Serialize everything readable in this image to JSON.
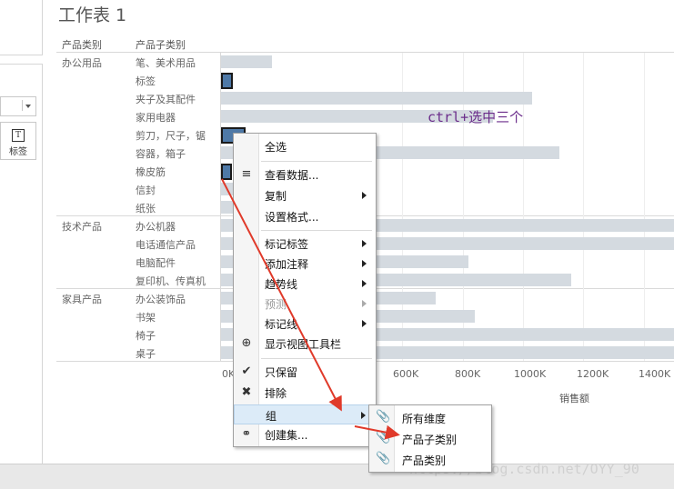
{
  "worksheet": {
    "title": "工作表 1",
    "col_category_header": "产品类别",
    "col_subcategory_header": "产品子类别",
    "axis_title": "销售额",
    "axis_ticks": [
      "0K",
      "600K",
      "800K",
      "1000K",
      "1200K",
      "1400K"
    ]
  },
  "left_panel": {
    "mark_label": "标签",
    "mark_icon_glyph": "T"
  },
  "categories": [
    {
      "name": "办公用品",
      "items": [
        "笔、美术用品",
        "标签",
        "夹子及其配件",
        "家用电器",
        "剪刀，尺子，锯",
        "容器，箱子",
        "橡皮筋",
        "信封",
        "纸张"
      ]
    },
    {
      "name": "技术产品",
      "items": [
        "办公机器",
        "电话通信产品",
        "电脑配件",
        "复印机、传真机"
      ]
    },
    {
      "name": "家具产品",
      "items": [
        "办公装饰品",
        "书架",
        "椅子",
        "桌子"
      ]
    }
  ],
  "chart_data": {
    "type": "bar",
    "orientation": "horizontal",
    "xlabel": "销售额",
    "xlim": [
      0,
      1500000
    ],
    "categories": [
      "笔、美术用品",
      "标签",
      "夹子及其配件",
      "家用电器",
      "剪刀，尺子，锯",
      "容器，箱子",
      "橡皮筋",
      "信封",
      "纸张",
      "办公机器",
      "电话通信产品",
      "电脑配件",
      "复印机、传真机",
      "办公装饰品",
      "书架",
      "椅子",
      "桌子"
    ],
    "values": [
      170000,
      40000,
      1030000,
      900000,
      80000,
      1120000,
      20000,
      170000,
      200000,
      1500000,
      1500000,
      820000,
      1160000,
      710000,
      840000,
      1500000,
      1500000
    ],
    "selected": [
      "标签",
      "剪刀，尺子，锯",
      "橡皮筋"
    ],
    "colors": {
      "bar": "#d4dae0",
      "selected": "#4e79a7"
    }
  },
  "annotation": "ctrl+选中三个",
  "context_menu": {
    "items": [
      "全选",
      "查看数据...",
      "复制",
      "设置格式...",
      "标记标签",
      "添加注释",
      "趋势线",
      "预测",
      "标记线",
      "显示视图工具栏",
      "只保留",
      "排除",
      "组",
      "创建集..."
    ]
  },
  "group_submenu": {
    "items": [
      "所有维度",
      "产品子类别",
      "产品类别"
    ]
  },
  "watermark": "https://blog.csdn.net/OYY_90"
}
